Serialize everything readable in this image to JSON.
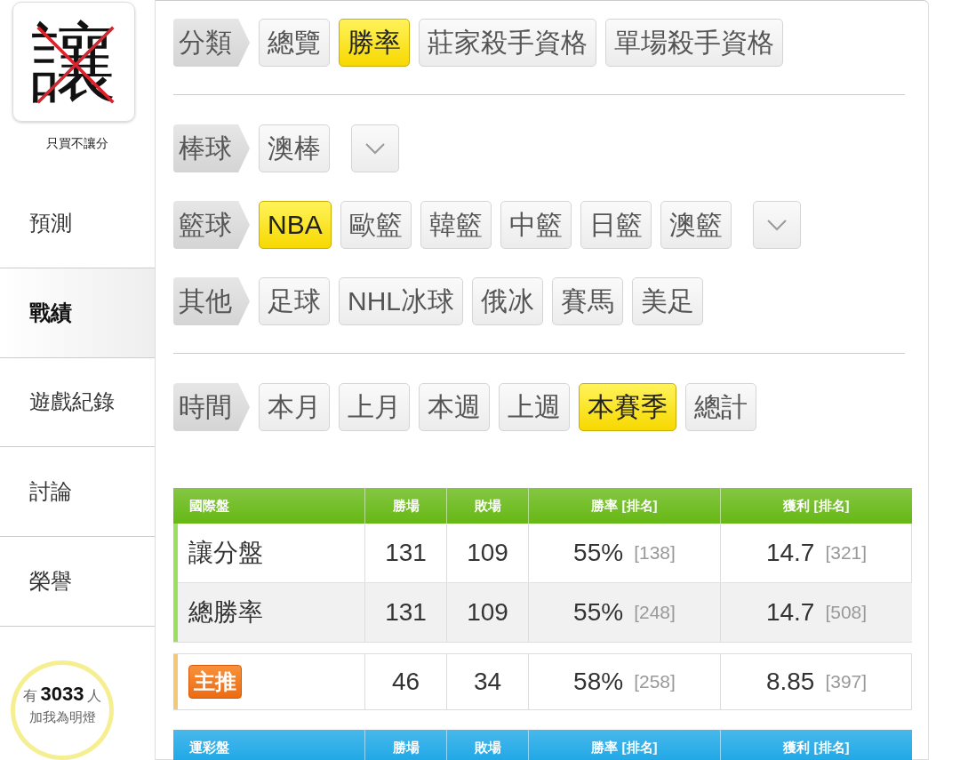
{
  "sidebar": {
    "logo": {
      "character": "讓",
      "crossed": true
    },
    "caption": "只買不讓分",
    "items": [
      {
        "label": "預測",
        "selected": false
      },
      {
        "label": "戰績",
        "selected": true
      },
      {
        "label": "遊戲紀錄",
        "selected": false
      },
      {
        "label": "討論",
        "selected": false
      },
      {
        "label": "榮譽",
        "selected": false
      }
    ],
    "followers": {
      "prefix": "有",
      "count": "3033",
      "suffix": "人",
      "caption": "加我為明燈"
    }
  },
  "filter_sections": [
    [
      {
        "label": "分類",
        "options": [
          {
            "label": "總覽",
            "selected": false
          },
          {
            "label": "勝率",
            "selected": true
          },
          {
            "label": "莊家殺手資格",
            "selected": false
          },
          {
            "label": "單場殺手資格",
            "selected": false
          }
        ]
      }
    ],
    [
      {
        "label": "棒球",
        "dropdown": true,
        "options": [
          {
            "label": "澳棒",
            "selected": false
          }
        ]
      },
      {
        "label": "籃球",
        "dropdown": true,
        "options": [
          {
            "label": "NBA",
            "selected": true
          },
          {
            "label": "歐籃",
            "selected": false
          },
          {
            "label": "韓籃",
            "selected": false
          },
          {
            "label": "中籃",
            "selected": false
          },
          {
            "label": "日籃",
            "selected": false
          },
          {
            "label": "澳籃",
            "selected": false
          }
        ]
      },
      {
        "label": "其他",
        "options": [
          {
            "label": "足球",
            "selected": false
          },
          {
            "label": "NHL冰球",
            "selected": false
          },
          {
            "label": "俄冰",
            "selected": false
          },
          {
            "label": "賽馬",
            "selected": false
          },
          {
            "label": "美足",
            "selected": false
          }
        ]
      }
    ],
    [
      {
        "label": "時間",
        "options": [
          {
            "label": "本月",
            "selected": false
          },
          {
            "label": "上月",
            "selected": false
          },
          {
            "label": "本週",
            "selected": false
          },
          {
            "label": "上週",
            "selected": false
          },
          {
            "label": "本賽季",
            "selected": true
          },
          {
            "label": "總計",
            "selected": false
          }
        ]
      }
    ]
  ],
  "tables": [
    {
      "color": "#66b814",
      "columns": [
        "國際盤",
        "勝場",
        "敗場",
        "勝率 [排名]",
        "獲利 [排名]"
      ],
      "row_groups": [
        {
          "color": "#9be05a",
          "rows": [
            {
              "kind": "label",
              "name": "讓分盤",
              "wins": "131",
              "losses": "109",
              "rate": "55%",
              "rate_rank": "[138]",
              "profit": "14.7",
              "profit_rank": "[321]"
            },
            {
              "kind": "label",
              "name": "總勝率",
              "wins": "131",
              "losses": "109",
              "rate": "55%",
              "rate_rank": "[248]",
              "profit": "14.7",
              "profit_rank": "[508]"
            }
          ]
        },
        {
          "color": "#f5c878",
          "rows": [
            {
              "kind": "badge",
              "name": "主推",
              "wins": "46",
              "losses": "34",
              "rate": "58%",
              "rate_rank": "[258]",
              "profit": "8.85",
              "profit_rank": "[397]"
            }
          ]
        }
      ]
    },
    {
      "color": "#1aa6e6",
      "columns": [
        "運彩盤",
        "勝場",
        "敗場",
        "勝率 [排名]",
        "獲利 [排名]"
      ]
    }
  ]
}
